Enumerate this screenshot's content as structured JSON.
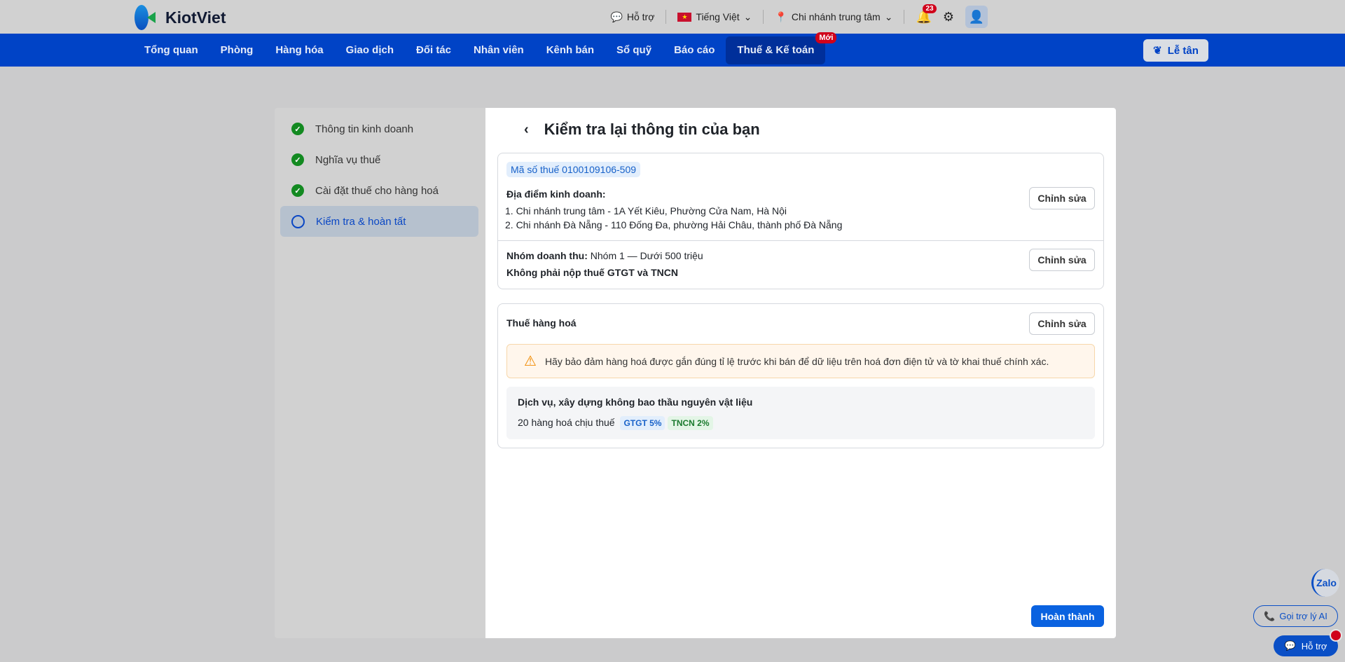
{
  "brand": "KiotViet",
  "topbar": {
    "support": "Hỗ trợ",
    "language": "Tiếng Việt",
    "branch": "Chi nhánh trung tâm",
    "notifications": "23"
  },
  "nav": {
    "items": [
      "Tổng quan",
      "Phòng",
      "Hàng hóa",
      "Giao dịch",
      "Đối tác",
      "Nhân viên",
      "Kênh bán",
      "Sổ quỹ",
      "Báo cáo",
      "Thuế & Kế toán"
    ],
    "new_badge": "Mới",
    "reception": "Lễ tân"
  },
  "steps": [
    "Thông tin kinh doanh",
    "Nghĩa vụ thuế",
    "Cài đặt thuế cho hàng hoá",
    "Kiểm tra & hoàn tất"
  ],
  "main": {
    "title": "Kiểm tra lại thông tin của bạn",
    "tax_code": "Mã số thuế 0100109106-509",
    "locations_label": "Địa điểm kinh doanh:",
    "locations": [
      "1.  Chi nhánh trung tâm - 1A Yết Kiêu, Phường Cửa Nam, Hà Nội",
      "2.  Chi nhánh Đà Nẵng - 110 Đống Đa, phường Hải Châu, thành phố Đà Nẵng"
    ],
    "revenue_label": "Nhóm doanh thu:",
    "revenue_value": "Nhóm 1 — Dưới 500 triệu",
    "tax_note": "Không phải nộp thuế GTGT và TNCN",
    "edit": "Chỉnh sửa",
    "goods_tax_title": "Thuế hàng hoá",
    "warning": "Hãy bảo đảm hàng hoá được gắn đúng tỉ lệ trước khi bán để dữ liệu trên hoá đơn điện tử và tờ khai thuế chính xác.",
    "group_title": "Dịch vụ, xây dựng không bao thầu nguyên vật liệu",
    "group_count": "20 hàng hoá chịu thuế",
    "tag_vat": "GTGT 5%",
    "tag_pit": "TNCN 2%",
    "finish": "Hoàn thành"
  },
  "floating": {
    "zalo": "Zalo",
    "ai": "Gọi trợ lý AI",
    "support": "Hỗ trợ"
  }
}
